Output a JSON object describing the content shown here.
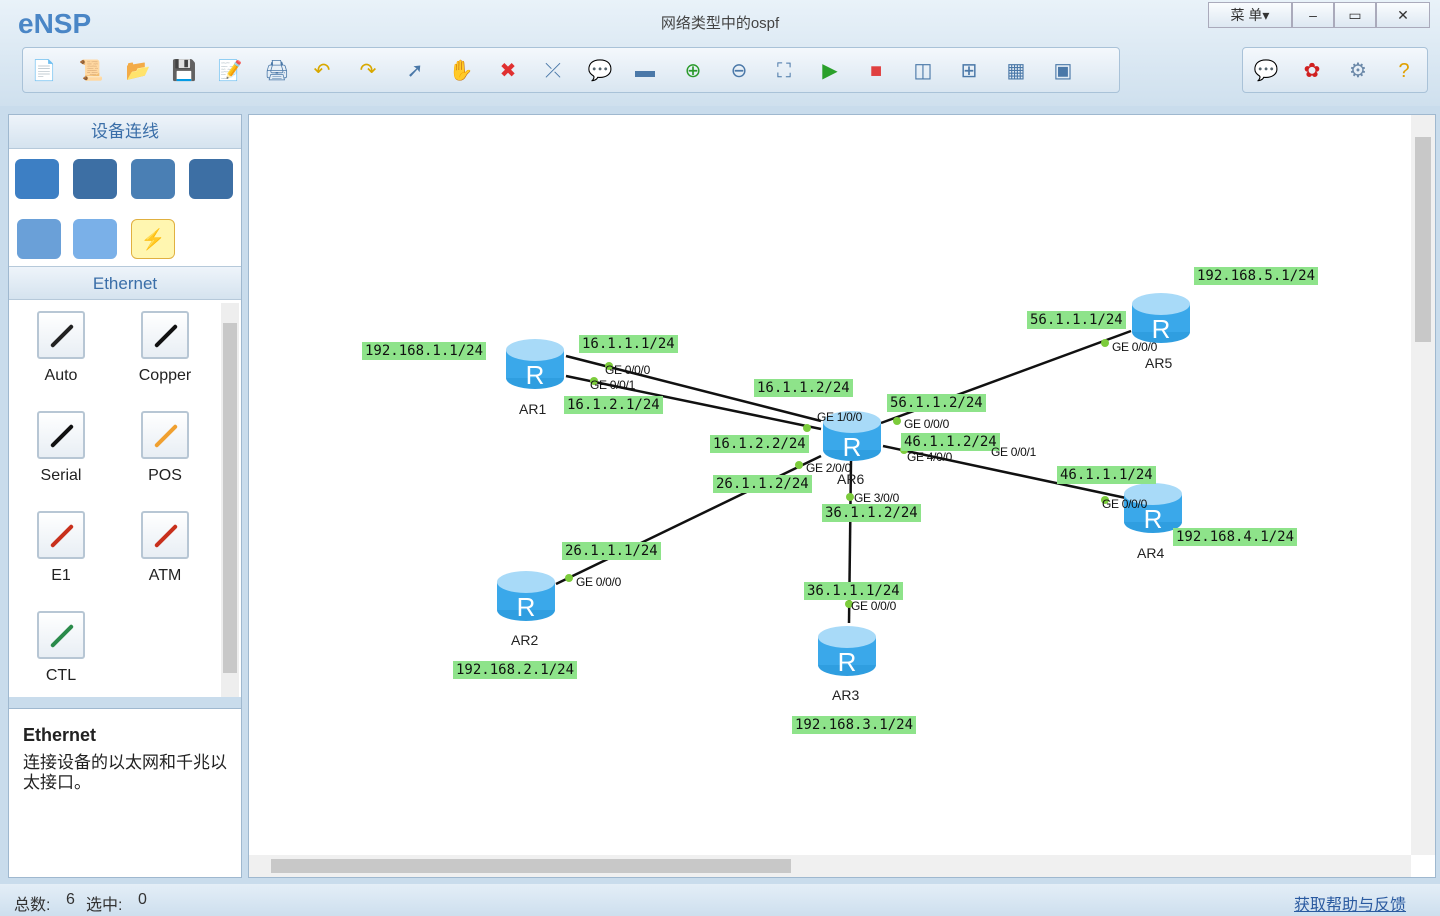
{
  "app": {
    "name": "eNSP",
    "title": "网络类型中的ospf",
    "menu_label": "菜 单▾"
  },
  "toolbar": {
    "icons": [
      "new-topology-icon",
      "new-script-icon",
      "open-icon",
      "save-icon",
      "save-as-icon",
      "print-icon",
      "undo-icon",
      "redo-icon",
      "select-icon",
      "pan-hand-icon",
      "delete-icon",
      "delete-link-icon",
      "text-note-icon",
      "rectangle-icon",
      "zoom-in-icon",
      "zoom-out-icon",
      "fit-view-icon",
      "start-device-icon",
      "stop-device-icon",
      "capture-icon",
      "topology-icon",
      "grid-icon",
      "cli-icon"
    ],
    "right_icons": [
      "chat-icon",
      "huawei-icon",
      "settings-icon",
      "help-icon"
    ]
  },
  "left_panel": {
    "header": "设备连线",
    "devices": [
      "router-icon",
      "switch-icon",
      "wlan-icon",
      "firewall-icon",
      "pc-icon",
      "cloud-icon",
      "link-icon"
    ],
    "category": "Ethernet",
    "cables": [
      {
        "label": "Auto",
        "color": "#222222"
      },
      {
        "label": "Copper",
        "color": "#111111"
      },
      {
        "label": "Serial",
        "color": "#111111"
      },
      {
        "label": "POS",
        "color": "#f0a030"
      },
      {
        "label": "E1",
        "color": "#c8301c"
      },
      {
        "label": "ATM",
        "color": "#c8301c"
      },
      {
        "label": "CTL",
        "color": "#2a8a4a"
      }
    ],
    "desc_title": "Ethernet",
    "desc_text": "连接设备的以太网和千兆以太接口。"
  },
  "topology": {
    "routers": [
      "AR1",
      "AR6",
      "AR5",
      "AR4",
      "AR2",
      "AR3"
    ],
    "ip_labels": [
      "192.168.1.1/24",
      "16.1.1.1/24",
      "16.1.2.1/24",
      "16.1.1.2/24",
      "16.1.2.2/24",
      "56.1.1.2/24",
      "46.1.1.2/24",
      "26.1.1.2/24",
      "36.1.1.2/24",
      "56.1.1.1/24",
      "192.168.5.1/24",
      "46.1.1.1/24",
      "192.168.4.1/24",
      "26.1.1.1/24",
      "192.168.2.1/24",
      "36.1.1.1/24",
      "192.168.3.1/24"
    ],
    "port_labels": [
      "GE 0/0/0",
      "GE 0/0/1",
      "GE 1/0/0",
      "GE 0/0/0",
      "GE 4/0/0",
      "GE 0/0/1",
      "GE 2/0/0",
      "GE 3/0/0",
      "GE 0/0/0",
      "GE 0/0/0",
      "GE 0/0/0",
      "GE 0/0/0"
    ],
    "link_color": "#111111",
    "port_dot_color": "#7ccc3c",
    "label_bg": "#8ee38a"
  },
  "status": {
    "total_label": "总数:",
    "total": "6",
    "selected_label": "选中:",
    "selected": "0",
    "help_link": "获取帮助与反馈"
  }
}
